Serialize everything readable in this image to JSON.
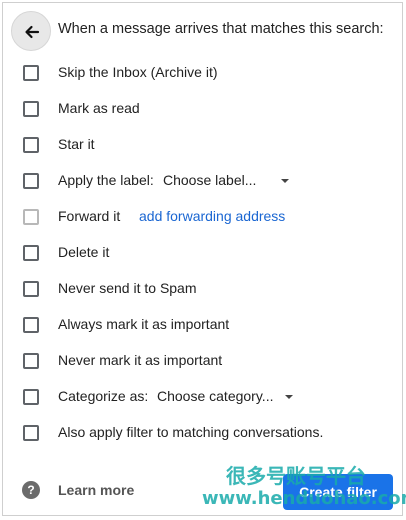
{
  "header": {
    "text": "When a message arrives that matches this search:"
  },
  "options": {
    "skip_inbox": "Skip the Inbox (Archive it)",
    "mark_read": "Mark as read",
    "star": "Star it",
    "apply_label": "Apply the label:",
    "label_dropdown": "Choose label...",
    "forward": "Forward it",
    "forward_link": "add forwarding address",
    "delete": "Delete it",
    "never_spam": "Never send it to Spam",
    "always_important": "Always mark it as important",
    "never_important": "Never mark it as important",
    "categorize": "Categorize as:",
    "category_dropdown": "Choose category...",
    "also_apply": "Also apply filter to matching conversations."
  },
  "footer": {
    "learn_more": "Learn more",
    "create_filter": "Create filter"
  },
  "watermark": {
    "line1": "很多号账号平台",
    "line2": "www.henduohao.com"
  },
  "colors": {
    "primary_button": "#1a73e8",
    "link": "#1a66d2"
  },
  "icons": {
    "back": "arrow-left-icon",
    "help": "help-circle-icon",
    "dropdown": "caret-down-icon"
  }
}
